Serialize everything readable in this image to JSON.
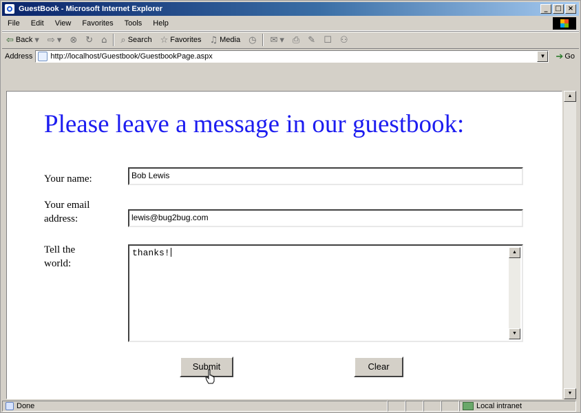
{
  "window": {
    "title": "GuestBook - Microsoft Internet Explorer"
  },
  "menu": [
    "File",
    "Edit",
    "View",
    "Favorites",
    "Tools",
    "Help"
  ],
  "toolbar": {
    "back": "Back",
    "search": "Search",
    "favorites": "Favorites",
    "media": "Media"
  },
  "address": {
    "label": "Address",
    "url": "http://localhost/Guestbook/GuestbookPage.aspx",
    "go": "Go"
  },
  "page": {
    "heading": "Please leave a message in our guestbook:",
    "name_label": "Your name:",
    "name_value": "Bob Lewis",
    "email_label_1": "Your email",
    "email_label_2": "address:",
    "email_value": "lewis@bug2bug.com",
    "message_label_1": "Tell the",
    "message_label_2": "world:",
    "message_value": "thanks!",
    "submit": "Submit",
    "clear": "Clear"
  },
  "status": {
    "text": "Done",
    "zone": "Local intranet"
  }
}
